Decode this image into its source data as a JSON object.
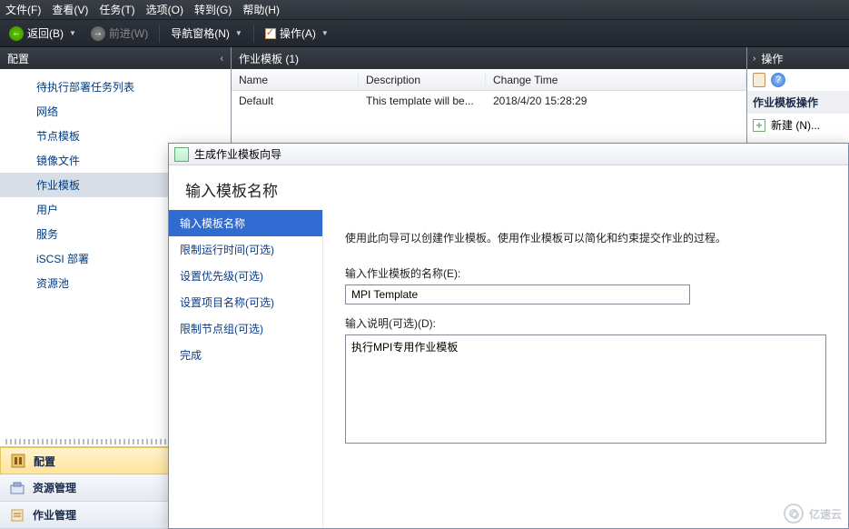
{
  "menu": {
    "file": "文件(F)",
    "view": "查看(V)",
    "tasks": "任务(T)",
    "options": "选项(O)",
    "goto": "转到(G)",
    "help": "帮助(H)"
  },
  "toolbar": {
    "back": "返回(B)",
    "forward": "前进(W)",
    "navpane": "导航窗格(N)",
    "actions": "操作(A)"
  },
  "left": {
    "panel_title": "配置",
    "tree": {
      "pending": "待执行部署任务列表",
      "network": "网络",
      "node_tpl": "节点模板",
      "image": "镜像文件",
      "job_tpl": "作业模板",
      "user": "用户",
      "service": "服务",
      "iscsi": "iSCSI 部署",
      "pool": "资源池"
    },
    "nav": {
      "config": "配置",
      "resource": "资源管理",
      "job": "作业管理"
    }
  },
  "center": {
    "panel_title": "作业模板 (1)",
    "cols": {
      "name": "Name",
      "desc": "Description",
      "time": "Change Time"
    },
    "rows": [
      {
        "name": "Default",
        "desc": "This template will be...",
        "time": "2018/4/20 15:28:29"
      }
    ]
  },
  "right": {
    "title": "操作",
    "section": "作业模板操作",
    "new": "新建 (N)..."
  },
  "wizard": {
    "title": "生成作业模板向导",
    "heading": "输入模板名称",
    "steps": {
      "s1": "输入模板名称",
      "s2": "限制运行时间(可选)",
      "s3": "设置优先级(可选)",
      "s4": "设置项目名称(可选)",
      "s5": "限制节点组(可选)",
      "s6": "完成"
    },
    "intro": "使用此向导可以创建作业模板。使用作业模板可以简化和约束提交作业的过程。",
    "name_label": "输入作业模板的名称(E):",
    "name_value": "MPI Template",
    "desc_label": "输入说明(可选)(D):",
    "desc_value": "执行MPI专用作业模板"
  },
  "watermark": "亿速云"
}
